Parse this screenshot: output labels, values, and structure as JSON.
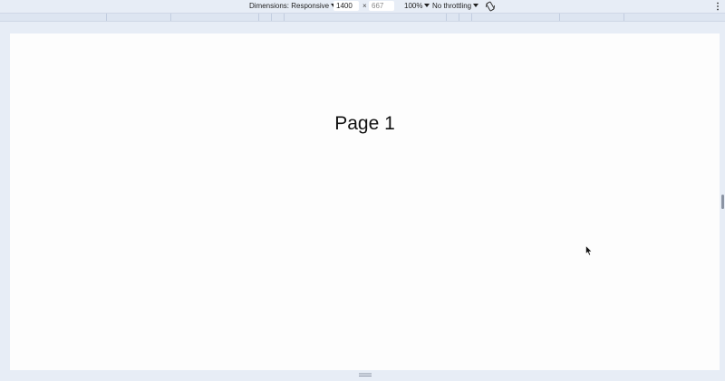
{
  "toolbar": {
    "dimensions_label": "Dimensions: Responsive",
    "width_value": "1400",
    "times_sign": "×",
    "height_value": "667",
    "zoom_label": "100%",
    "throttling_label": "No throttling",
    "rotate_icon": "rotate-icon",
    "menu_icon": "more-vertical-icon"
  },
  "page": {
    "title": "Page 1"
  },
  "colors": {
    "chrome_background": "#e7edf6",
    "page_background": "#fdfdfd",
    "breakpoint_bar": "#dde5f1"
  }
}
